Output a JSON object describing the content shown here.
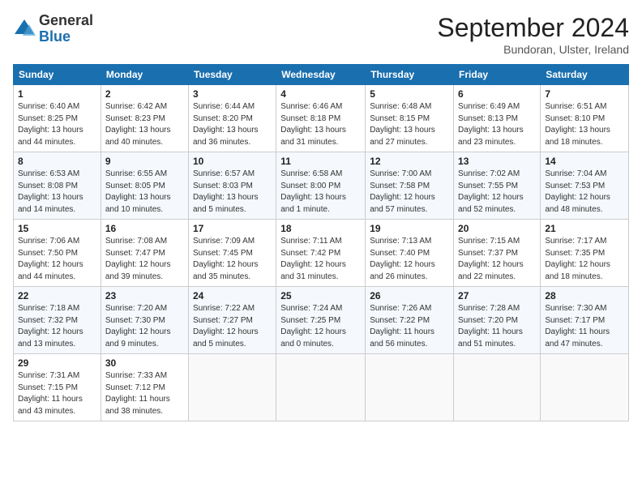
{
  "header": {
    "logo_general": "General",
    "logo_blue": "Blue",
    "month_title": "September 2024",
    "location": "Bundoran, Ulster, Ireland"
  },
  "days_of_week": [
    "Sunday",
    "Monday",
    "Tuesday",
    "Wednesday",
    "Thursday",
    "Friday",
    "Saturday"
  ],
  "weeks": [
    [
      {
        "day": "1",
        "info": "Sunrise: 6:40 AM\nSunset: 8:25 PM\nDaylight: 13 hours\nand 44 minutes."
      },
      {
        "day": "2",
        "info": "Sunrise: 6:42 AM\nSunset: 8:23 PM\nDaylight: 13 hours\nand 40 minutes."
      },
      {
        "day": "3",
        "info": "Sunrise: 6:44 AM\nSunset: 8:20 PM\nDaylight: 13 hours\nand 36 minutes."
      },
      {
        "day": "4",
        "info": "Sunrise: 6:46 AM\nSunset: 8:18 PM\nDaylight: 13 hours\nand 31 minutes."
      },
      {
        "day": "5",
        "info": "Sunrise: 6:48 AM\nSunset: 8:15 PM\nDaylight: 13 hours\nand 27 minutes."
      },
      {
        "day": "6",
        "info": "Sunrise: 6:49 AM\nSunset: 8:13 PM\nDaylight: 13 hours\nand 23 minutes."
      },
      {
        "day": "7",
        "info": "Sunrise: 6:51 AM\nSunset: 8:10 PM\nDaylight: 13 hours\nand 18 minutes."
      }
    ],
    [
      {
        "day": "8",
        "info": "Sunrise: 6:53 AM\nSunset: 8:08 PM\nDaylight: 13 hours\nand 14 minutes."
      },
      {
        "day": "9",
        "info": "Sunrise: 6:55 AM\nSunset: 8:05 PM\nDaylight: 13 hours\nand 10 minutes."
      },
      {
        "day": "10",
        "info": "Sunrise: 6:57 AM\nSunset: 8:03 PM\nDaylight: 13 hours\nand 5 minutes."
      },
      {
        "day": "11",
        "info": "Sunrise: 6:58 AM\nSunset: 8:00 PM\nDaylight: 13 hours\nand 1 minute."
      },
      {
        "day": "12",
        "info": "Sunrise: 7:00 AM\nSunset: 7:58 PM\nDaylight: 12 hours\nand 57 minutes."
      },
      {
        "day": "13",
        "info": "Sunrise: 7:02 AM\nSunset: 7:55 PM\nDaylight: 12 hours\nand 52 minutes."
      },
      {
        "day": "14",
        "info": "Sunrise: 7:04 AM\nSunset: 7:53 PM\nDaylight: 12 hours\nand 48 minutes."
      }
    ],
    [
      {
        "day": "15",
        "info": "Sunrise: 7:06 AM\nSunset: 7:50 PM\nDaylight: 12 hours\nand 44 minutes."
      },
      {
        "day": "16",
        "info": "Sunrise: 7:08 AM\nSunset: 7:47 PM\nDaylight: 12 hours\nand 39 minutes."
      },
      {
        "day": "17",
        "info": "Sunrise: 7:09 AM\nSunset: 7:45 PM\nDaylight: 12 hours\nand 35 minutes."
      },
      {
        "day": "18",
        "info": "Sunrise: 7:11 AM\nSunset: 7:42 PM\nDaylight: 12 hours\nand 31 minutes."
      },
      {
        "day": "19",
        "info": "Sunrise: 7:13 AM\nSunset: 7:40 PM\nDaylight: 12 hours\nand 26 minutes."
      },
      {
        "day": "20",
        "info": "Sunrise: 7:15 AM\nSunset: 7:37 PM\nDaylight: 12 hours\nand 22 minutes."
      },
      {
        "day": "21",
        "info": "Sunrise: 7:17 AM\nSunset: 7:35 PM\nDaylight: 12 hours\nand 18 minutes."
      }
    ],
    [
      {
        "day": "22",
        "info": "Sunrise: 7:18 AM\nSunset: 7:32 PM\nDaylight: 12 hours\nand 13 minutes."
      },
      {
        "day": "23",
        "info": "Sunrise: 7:20 AM\nSunset: 7:30 PM\nDaylight: 12 hours\nand 9 minutes."
      },
      {
        "day": "24",
        "info": "Sunrise: 7:22 AM\nSunset: 7:27 PM\nDaylight: 12 hours\nand 5 minutes."
      },
      {
        "day": "25",
        "info": "Sunrise: 7:24 AM\nSunset: 7:25 PM\nDaylight: 12 hours\nand 0 minutes."
      },
      {
        "day": "26",
        "info": "Sunrise: 7:26 AM\nSunset: 7:22 PM\nDaylight: 11 hours\nand 56 minutes."
      },
      {
        "day": "27",
        "info": "Sunrise: 7:28 AM\nSunset: 7:20 PM\nDaylight: 11 hours\nand 51 minutes."
      },
      {
        "day": "28",
        "info": "Sunrise: 7:30 AM\nSunset: 7:17 PM\nDaylight: 11 hours\nand 47 minutes."
      }
    ],
    [
      {
        "day": "29",
        "info": "Sunrise: 7:31 AM\nSunset: 7:15 PM\nDaylight: 11 hours\nand 43 minutes."
      },
      {
        "day": "30",
        "info": "Sunrise: 7:33 AM\nSunset: 7:12 PM\nDaylight: 11 hours\nand 38 minutes."
      },
      {
        "day": "",
        "info": ""
      },
      {
        "day": "",
        "info": ""
      },
      {
        "day": "",
        "info": ""
      },
      {
        "day": "",
        "info": ""
      },
      {
        "day": "",
        "info": ""
      }
    ]
  ]
}
